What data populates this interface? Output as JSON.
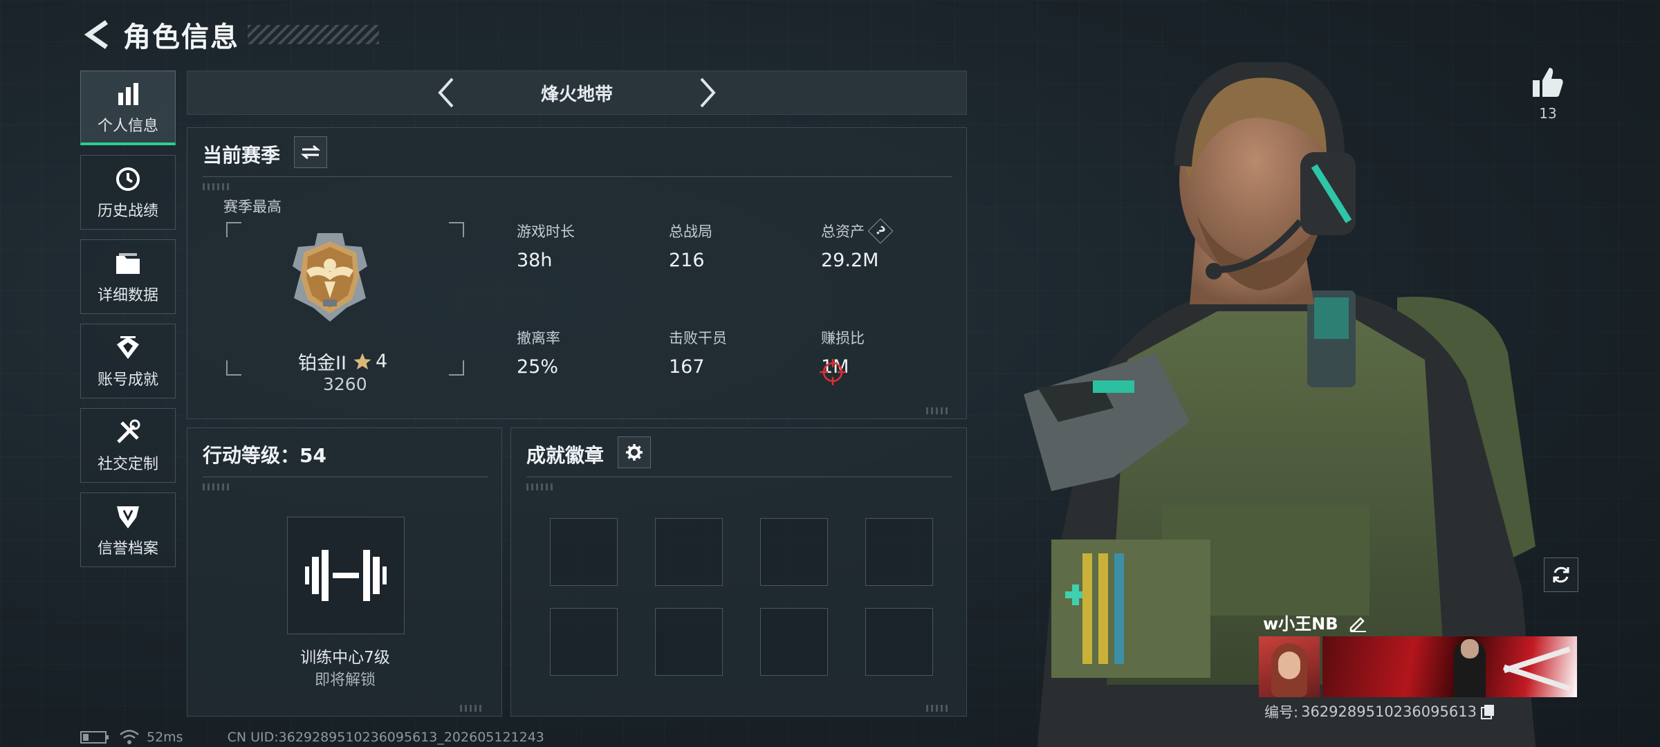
{
  "header": {
    "title": "角色信息"
  },
  "sidebar": {
    "items": [
      {
        "label": "个人信息",
        "active": true
      },
      {
        "label": "历史战绩"
      },
      {
        "label": "详细数据"
      },
      {
        "label": "账号成就"
      },
      {
        "label": "社交定制"
      },
      {
        "label": "信誉档案"
      }
    ]
  },
  "mode": {
    "title": "烽火地带"
  },
  "season": {
    "title": "当前赛季",
    "best_label": "赛季最高",
    "rank_name": "铂金II",
    "rank_stars": "4",
    "rank_score": "3260",
    "stats": [
      {
        "label": "游戏时长",
        "value": "38h"
      },
      {
        "label": "总战局",
        "value": "216"
      },
      {
        "label": "总资产",
        "value": "29.2M",
        "help": "?"
      },
      {
        "label": "撤离率",
        "value": "25%"
      },
      {
        "label": "击败干员",
        "value": "167"
      },
      {
        "label": "赚损比",
        "value": "1M"
      }
    ]
  },
  "action_level": {
    "title": "行动等级：54",
    "unlock_title": "训练中心7级",
    "unlock_sub": "即将解锁"
  },
  "achievements": {
    "title": "成就徽章"
  },
  "likes": {
    "count": "13"
  },
  "player": {
    "name": "w小王NB",
    "uid_label": "编号:",
    "uid": "3629289510236095613"
  },
  "status": {
    "ping": "52ms",
    "uid_text": "CN UID:3629289510236095613_202605121243"
  },
  "colors": {
    "accent": "#27d08f",
    "background": "#1a2329"
  }
}
